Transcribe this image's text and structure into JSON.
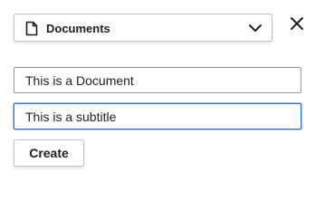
{
  "type_select": {
    "selected": "Documents",
    "icon": "document-icon",
    "dropdown_icon": "chevron-down-icon"
  },
  "close": {
    "icon": "close-icon"
  },
  "form": {
    "title_value": "This is a Document",
    "subtitle_value": "This is a subtitle",
    "create_label": "Create"
  },
  "colors": {
    "focus_border": "#3a78c9",
    "text": "#1e1e1e",
    "border": "#c3c4c7"
  }
}
